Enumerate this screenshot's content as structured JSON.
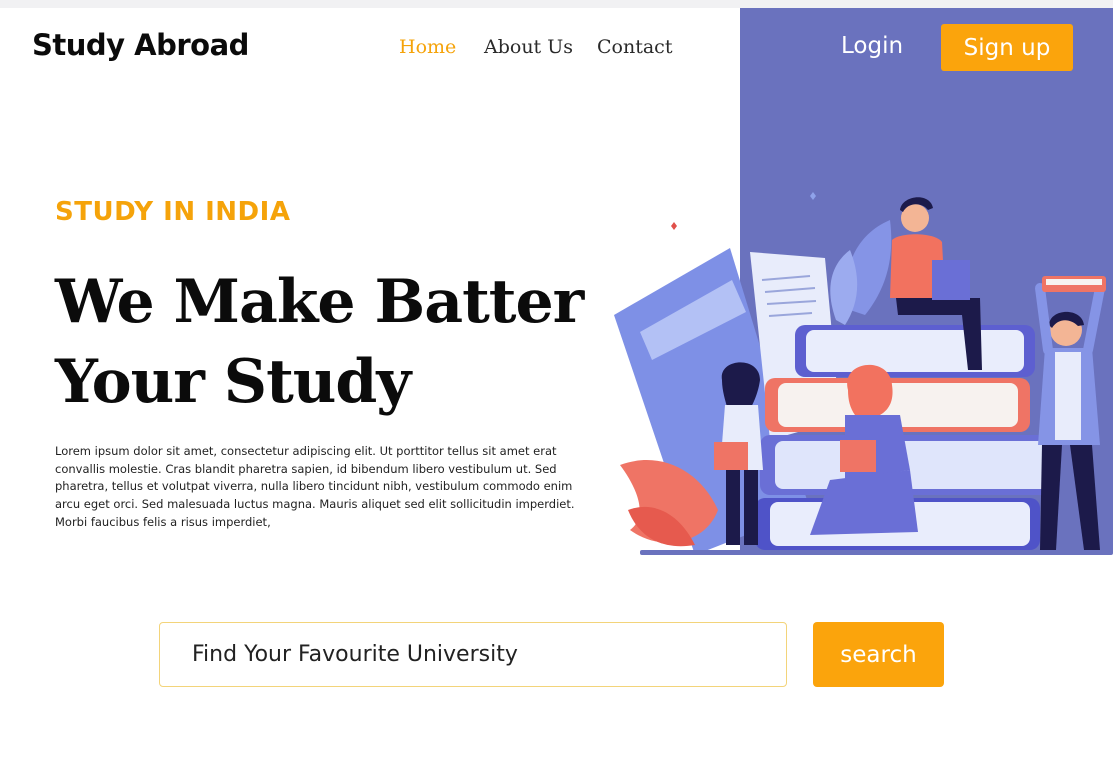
{
  "brand": {
    "name": "Study Abroad"
  },
  "nav": {
    "items": [
      {
        "label": "Home",
        "active": true
      },
      {
        "label": "About Us",
        "active": false
      },
      {
        "label": "Contact",
        "active": false
      }
    ]
  },
  "auth": {
    "login_label": "Login",
    "signup_label": "Sign up"
  },
  "hero": {
    "eyebrow": "STUDY IN INDIA",
    "headline_line1": "We Make Batter",
    "headline_line2": "Your Study",
    "description": "Lorem ipsum dolor sit amet, consectetur adipiscing elit. Ut porttitor tellus sit amet erat convallis molestie. Cras blandit pharetra sapien, id bibendum libero vestibulum ut. Sed pharetra, tellus et volutpat viverra, nulla libero tincidunt nibh, vestibulum commodo enim arcu eget orci. Sed malesuada luctus magna. Mauris aliquet sed elit sollicitudin imperdiet. Morbi faucibus felis a risus imperdiet,"
  },
  "search": {
    "placeholder": "Find Your Favourite University",
    "button_label": "search"
  },
  "colors": {
    "accent": "#fba40c",
    "panel": "#6a72be",
    "text": "#0b0b0b"
  },
  "illustration": {
    "name": "students-with-books-illustration"
  }
}
